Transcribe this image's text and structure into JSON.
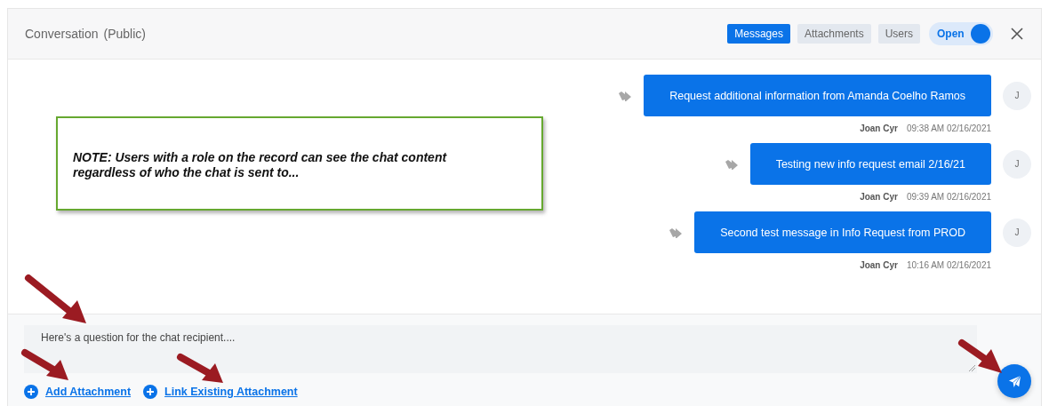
{
  "header": {
    "title": "Conversation",
    "visibility": "(Public)",
    "tabs": [
      {
        "label": "Messages",
        "selected": true
      },
      {
        "label": "Attachments",
        "selected": false
      },
      {
        "label": "Users",
        "selected": false
      }
    ],
    "toggle": {
      "label": "Open",
      "on": true
    }
  },
  "messages": [
    {
      "text": "Request additional information from Amanda Coelho Ramos",
      "author": "Joan Cyr",
      "time": "09:38 AM 02/16/2021",
      "avatar": "J"
    },
    {
      "text": "Testing new info request email 2/16/21",
      "author": "Joan Cyr",
      "time": "09:39 AM 02/16/2021",
      "avatar": "J"
    },
    {
      "text": "Second test message in Info Request from PROD",
      "author": "Joan Cyr",
      "time": "10:16 AM 02/16/2021",
      "avatar": "J"
    }
  ],
  "note": "NOTE: Users with a role on the record can see the chat content regardless of who the chat is sent to...",
  "composer": {
    "value": "Here's a question for the chat recipient....",
    "links": [
      "Add Attachment",
      "Link Existing Attachment"
    ]
  }
}
